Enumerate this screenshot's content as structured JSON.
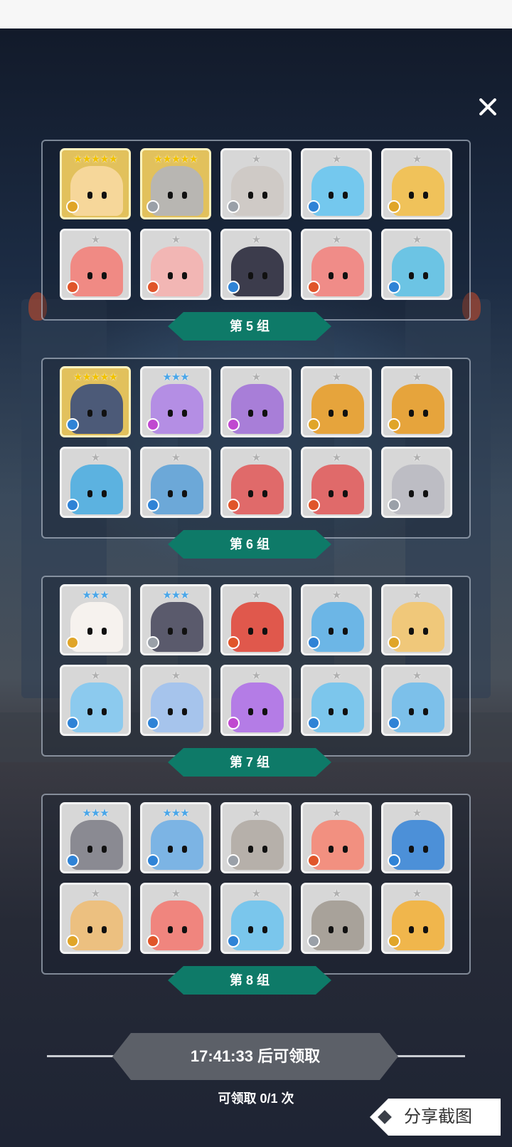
{
  "close_label": "✕",
  "groups": [
    {
      "label": "第 5 组",
      "cards": [
        {
          "stars": "★★★★★",
          "star_tier": "gold",
          "element": "earth",
          "rare": true,
          "color": "#f6d79a"
        },
        {
          "stars": "★★★★★",
          "star_tier": "gold",
          "element": "light",
          "rare": true,
          "color": "#b8b6b2"
        },
        {
          "stars": "★",
          "star_tier": "grey",
          "element": "light",
          "rare": false,
          "color": "#cfcac6"
        },
        {
          "stars": "★",
          "star_tier": "grey",
          "element": "water",
          "rare": false,
          "color": "#74c8ee"
        },
        {
          "stars": "★",
          "star_tier": "grey",
          "element": "earth",
          "rare": false,
          "color": "#f0c25a"
        },
        {
          "stars": "★",
          "star_tier": "grey",
          "element": "fire",
          "rare": false,
          "color": "#f08a84"
        },
        {
          "stars": "★",
          "star_tier": "grey",
          "element": "fire",
          "rare": false,
          "color": "#f2b6b4"
        },
        {
          "stars": "★",
          "star_tier": "grey",
          "element": "water",
          "rare": false,
          "color": "#3c3c4c"
        },
        {
          "stars": "★",
          "star_tier": "grey",
          "element": "fire",
          "rare": false,
          "color": "#f08c88"
        },
        {
          "stars": "★",
          "star_tier": "grey",
          "element": "water",
          "rare": false,
          "color": "#6cc4e4"
        }
      ]
    },
    {
      "label": "第 6 组",
      "cards": [
        {
          "stars": "★★★★★",
          "star_tier": "gold",
          "element": "water",
          "rare": true,
          "color": "#4c5a78"
        },
        {
          "stars": "★★★",
          "star_tier": "blue",
          "element": "dark",
          "rare": false,
          "color": "#b48ee4"
        },
        {
          "stars": "★",
          "star_tier": "grey",
          "element": "dark",
          "rare": false,
          "color": "#a87ed8"
        },
        {
          "stars": "★",
          "star_tier": "grey",
          "element": "earth",
          "rare": false,
          "color": "#e6a43c"
        },
        {
          "stars": "★",
          "star_tier": "grey",
          "element": "earth",
          "rare": false,
          "color": "#e6a43c"
        },
        {
          "stars": "★",
          "star_tier": "grey",
          "element": "water",
          "rare": false,
          "color": "#5cb2e0"
        },
        {
          "stars": "★",
          "star_tier": "grey",
          "element": "water",
          "rare": false,
          "color": "#6ca8d8"
        },
        {
          "stars": "★",
          "star_tier": "grey",
          "element": "fire",
          "rare": false,
          "color": "#e06a6a"
        },
        {
          "stars": "★",
          "star_tier": "grey",
          "element": "fire",
          "rare": false,
          "color": "#e06a6a"
        },
        {
          "stars": "★",
          "star_tier": "grey",
          "element": "light",
          "rare": false,
          "color": "#bdbdc4"
        }
      ]
    },
    {
      "label": "第 7 组",
      "cards": [
        {
          "stars": "★★★",
          "star_tier": "blue",
          "element": "earth",
          "rare": false,
          "color": "#f6f2ee"
        },
        {
          "stars": "★★★",
          "star_tier": "blue",
          "element": "light",
          "rare": false,
          "color": "#5a5a6c"
        },
        {
          "stars": "★",
          "star_tier": "grey",
          "element": "fire",
          "rare": false,
          "color": "#e0584c"
        },
        {
          "stars": "★",
          "star_tier": "grey",
          "element": "water",
          "rare": false,
          "color": "#6cb6e6"
        },
        {
          "stars": "★",
          "star_tier": "grey",
          "element": "earth",
          "rare": false,
          "color": "#f0c87a"
        },
        {
          "stars": "★",
          "star_tier": "grey",
          "element": "water",
          "rare": false,
          "color": "#8ccaee"
        },
        {
          "stars": "★",
          "star_tier": "grey",
          "element": "water",
          "rare": false,
          "color": "#a6c4ec"
        },
        {
          "stars": "★",
          "star_tier": "grey",
          "element": "dark",
          "rare": false,
          "color": "#b47ce6"
        },
        {
          "stars": "★",
          "star_tier": "grey",
          "element": "water",
          "rare": false,
          "color": "#7cc6ec"
        },
        {
          "stars": "★",
          "star_tier": "grey",
          "element": "water",
          "rare": false,
          "color": "#7cc0ea"
        }
      ]
    },
    {
      "label": "第 8 组",
      "cards": [
        {
          "stars": "★★★",
          "star_tier": "blue",
          "element": "water",
          "rare": false,
          "color": "#8a8a92"
        },
        {
          "stars": "★★★",
          "star_tier": "blue",
          "element": "water",
          "rare": false,
          "color": "#7cb4e4"
        },
        {
          "stars": "★",
          "star_tier": "grey",
          "element": "light",
          "rare": false,
          "color": "#b6b0aa"
        },
        {
          "stars": "★",
          "star_tier": "grey",
          "element": "fire",
          "rare": false,
          "color": "#f29080"
        },
        {
          "stars": "★",
          "star_tier": "grey",
          "element": "water",
          "rare": false,
          "color": "#4c90d8"
        },
        {
          "stars": "★",
          "star_tier": "grey",
          "element": "earth",
          "rare": false,
          "color": "#ecc080"
        },
        {
          "stars": "★",
          "star_tier": "grey",
          "element": "fire",
          "rare": false,
          "color": "#f0857e"
        },
        {
          "stars": "★",
          "star_tier": "grey",
          "element": "water",
          "rare": false,
          "color": "#7ac6ec"
        },
        {
          "stars": "★",
          "star_tier": "grey",
          "element": "light",
          "rare": false,
          "color": "#a8a29a"
        },
        {
          "stars": "★",
          "star_tier": "grey",
          "element": "earth",
          "rare": false,
          "color": "#f0b64c"
        }
      ]
    }
  ],
  "timer": {
    "label": "17:41:33 后可领取"
  },
  "claim": {
    "label": "可领取 0/1 次"
  },
  "share": {
    "label": "分享截图"
  }
}
